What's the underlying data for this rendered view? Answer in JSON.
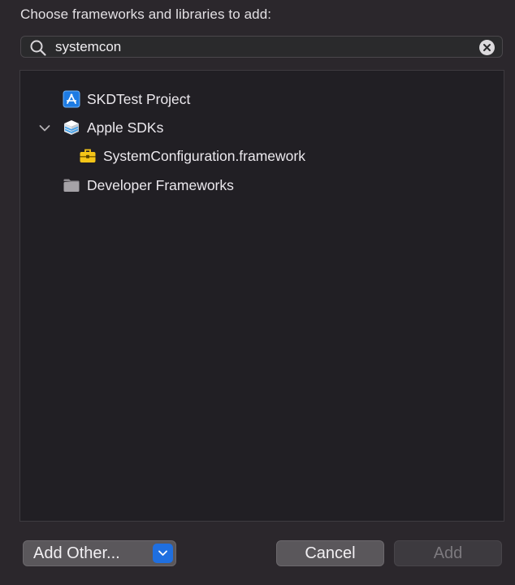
{
  "dialog": {
    "prompt": "Choose frameworks and libraries to add:"
  },
  "search": {
    "value": "systemcon",
    "icon": "magnifying-glass",
    "clear_icon": "x-circle"
  },
  "tree": {
    "items": [
      {
        "label": "SKDTest Project",
        "icon": "xcode-project-icon",
        "level": 0
      },
      {
        "label": "Apple SDKs",
        "icon": "sdk-stack-icon",
        "level": 0,
        "expanded": true
      },
      {
        "label": "SystemConfiguration.framework",
        "icon": "toolbox-icon",
        "level": 1
      },
      {
        "label": "Developer Frameworks",
        "icon": "folder-icon",
        "level": 0
      }
    ]
  },
  "buttons": {
    "add_other": "Add Other...",
    "cancel": "Cancel",
    "add": "Add"
  },
  "colors": {
    "accent": "#1f6fe0",
    "background": "#2b272c",
    "list_background": "#211f24",
    "toolbox_yellow": "#f5c518"
  }
}
